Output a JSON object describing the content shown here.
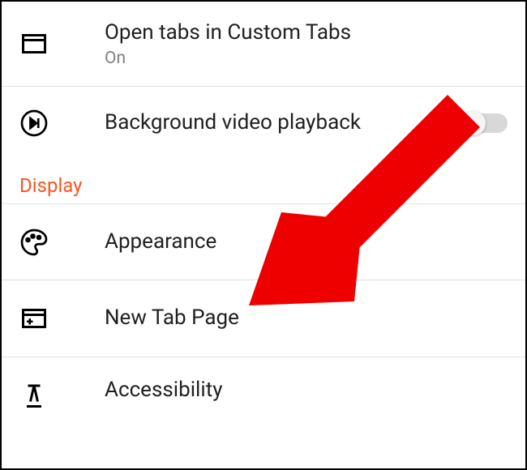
{
  "settings": {
    "customTabs": {
      "label": "Open tabs in Custom Tabs",
      "value": "On"
    },
    "backgroundVideo": {
      "label": "Background video playback",
      "toggleOn": false
    },
    "sectionHeader": "Display",
    "appearance": {
      "label": "Appearance"
    },
    "newTabPage": {
      "label": "New Tab Page"
    },
    "accessibility": {
      "label": "Accessibility"
    }
  }
}
